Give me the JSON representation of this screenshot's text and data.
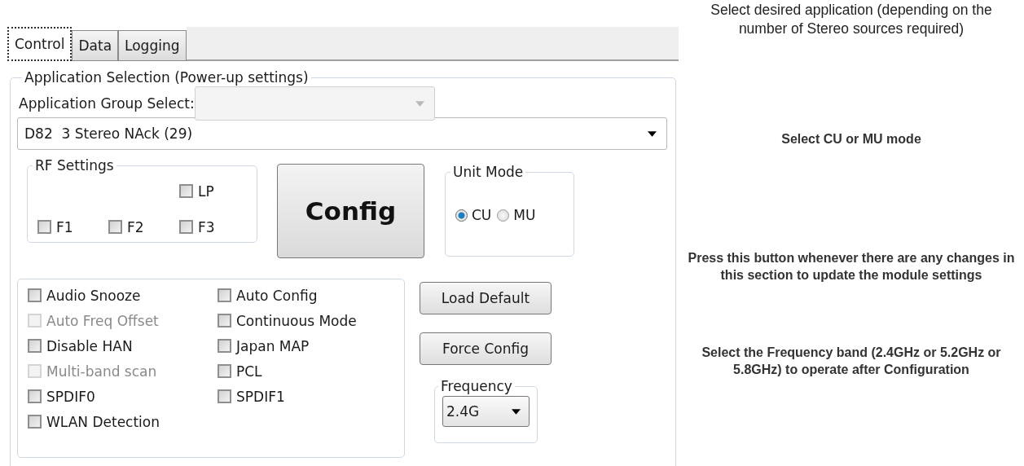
{
  "tabs": [
    {
      "label": "Control",
      "selected": true
    },
    {
      "label": "Data",
      "selected": false
    },
    {
      "label": "Logging",
      "selected": false
    }
  ],
  "application_selection": {
    "legend": "Application Selection (Power-up settings)",
    "group_select": {
      "label": "Application Group Select:",
      "disabled": true
    },
    "application": {
      "value": "D82  3 Stereo NAck (29)"
    }
  },
  "rf_settings": {
    "legend": "RF Settings",
    "checkboxes": [
      {
        "label": "LP",
        "checked": false
      },
      {
        "label": "F1",
        "checked": false
      },
      {
        "label": "F2",
        "checked": false
      },
      {
        "label": "F3",
        "checked": false
      }
    ]
  },
  "config_button": "Config",
  "unit_mode": {
    "legend": "Unit Mode",
    "options": [
      {
        "label": "CU",
        "selected": true
      },
      {
        "label": "MU",
        "selected": false
      }
    ]
  },
  "options": [
    {
      "label": "Audio Snooze",
      "checked": false,
      "disabled": false
    },
    {
      "label": "Auto Config",
      "checked": false,
      "disabled": false
    },
    {
      "label": "Auto Freq Offset",
      "checked": false,
      "disabled": true
    },
    {
      "label": "Continuous Mode",
      "checked": false,
      "disabled": false
    },
    {
      "label": "Disable HAN",
      "checked": false,
      "disabled": false
    },
    {
      "label": "Japan MAP",
      "checked": false,
      "disabled": false
    },
    {
      "label": "Multi-band scan",
      "checked": false,
      "disabled": true
    },
    {
      "label": "PCL",
      "checked": false,
      "disabled": false
    },
    {
      "label": "SPDIF0",
      "checked": false,
      "disabled": false
    },
    {
      "label": "SPDIF1",
      "checked": false,
      "disabled": false
    },
    {
      "label": "WLAN Detection",
      "checked": false,
      "disabled": false
    }
  ],
  "buttons": [
    "Load Default",
    "Force Config"
  ],
  "frequency": {
    "legend": "Frequency",
    "value": "2.4G"
  },
  "annotations": [
    {
      "text": "Select desired application (depending on the number of Stereo sources required)",
      "bold": false
    },
    {
      "text": "Select CU or MU mode",
      "bold": true
    },
    {
      "text": "Press this button whenever there are any changes in this section to update the module settings",
      "bold": true
    },
    {
      "text": "Select the Frequency band (2.4GHz or 5.2GHz or 5.8GHz) to operate after Configuration",
      "bold": true
    }
  ]
}
